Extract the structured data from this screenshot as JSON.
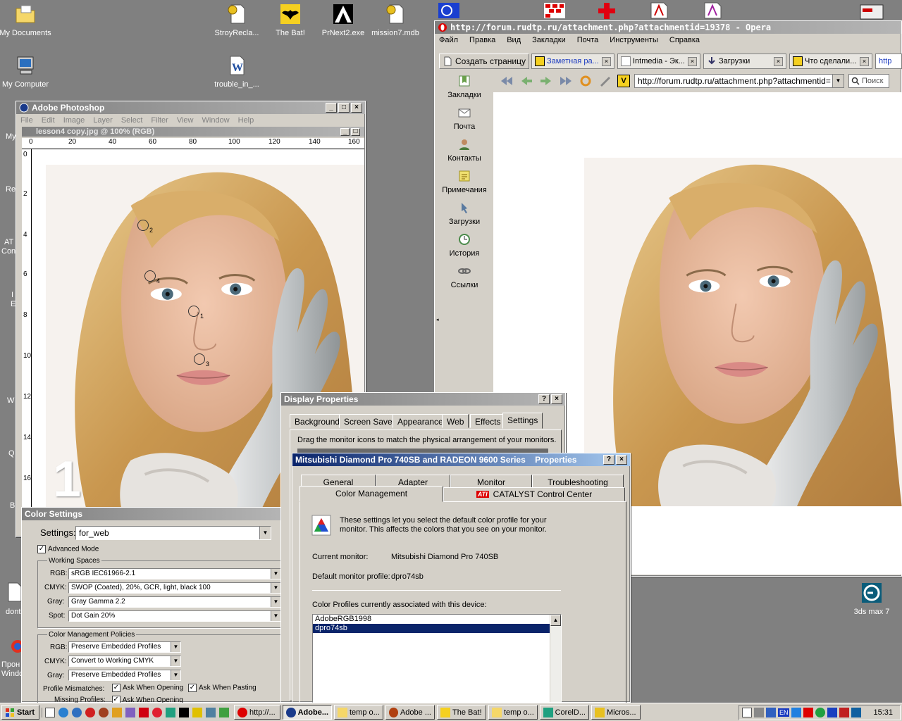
{
  "desktop": {
    "icons": [
      {
        "name": "my-documents",
        "label": "My Documents"
      },
      {
        "name": "my-computer",
        "label": "My Computer"
      },
      {
        "name": "stroyrecla",
        "label": "StroyRecla..."
      },
      {
        "name": "the-bat",
        "label": "The Bat!"
      },
      {
        "name": "prnext2",
        "label": "PrNext2.exe"
      },
      {
        "name": "mission7",
        "label": "mission7.mdb"
      },
      {
        "name": "trouble-in",
        "label": "trouble_in_..."
      },
      {
        "name": "max7",
        "label": "3ds max 7"
      }
    ],
    "edge_labels": [
      "My",
      "Re",
      "AT",
      "Con",
      "I",
      "E",
      "W",
      "Q",
      "B",
      "dont",
      "Прон",
      "Windo"
    ]
  },
  "photoshop": {
    "title": "Adobe Photoshop",
    "menu": [
      "File",
      "Edit",
      "Image",
      "Layer",
      "Select",
      "Filter",
      "View",
      "Window",
      "Help"
    ],
    "doc_title": "lesson4 copy.jpg @ 100% (RGB)",
    "ruler_h": [
      "0",
      "20",
      "40",
      "60",
      "80",
      "100",
      "120",
      "140",
      "160"
    ],
    "ruler_v": [
      "0",
      "2",
      "4",
      "6",
      "8",
      "10",
      "12",
      "14",
      "16"
    ],
    "samplers": [
      "2",
      "4",
      "1",
      "3"
    ],
    "big_number": "1"
  },
  "color_settings": {
    "title": "Color Settings",
    "settings_label": "Settings:",
    "settings_value": "for_web",
    "advanced_mode": "Advanced Mode",
    "working_spaces": "Working Spaces",
    "rgb_label": "RGB:",
    "rgb_value": "sRGB IEC61966-2.1",
    "cmyk_label": "CMYK:",
    "cmyk_value": "SWOP (Coated), 20%, GCR, light, black 100",
    "gray_label": "Gray:",
    "gray_value": "Gray Gamma 2.2",
    "spot_label": "Spot:",
    "spot_value": "Dot Gain 20%",
    "policies": "Color Management Policies",
    "p_rgb_value": "Preserve Embedded Profiles",
    "p_cmyk_value": "Convert to Working CMYK",
    "p_gray_value": "Preserve Embedded Profiles",
    "mismatch_label": "Profile Mismatches:",
    "ask_opening": "Ask When Opening",
    "ask_pasting": "Ask When Pasting",
    "missing_label": "Missing Profiles:"
  },
  "opera": {
    "title": "http://forum.rudtp.ru/attachment.php?attachmentid=19378 - Opera",
    "menu": [
      "Файл",
      "Правка",
      "Вид",
      "Закладки",
      "Почта",
      "Инструменты",
      "Справка"
    ],
    "new_page": "Создать страницу",
    "tabs": [
      "Заметная ра...",
      "Intmedia - Эк...",
      "Загрузки",
      "Что сделали...",
      "http"
    ],
    "address": "http://forum.rudtp.ru/attachment.php?attachmentid=",
    "search_placeholder": "Поиск",
    "sidebar": [
      "Закладки",
      "Почта",
      "Контакты",
      "Примечания",
      "Загрузки",
      "История",
      "Ссылки"
    ]
  },
  "display_props": {
    "title": "Display Properties",
    "tabs": [
      "Background",
      "Screen Saver",
      "Appearance",
      "Web",
      "Effects",
      "Settings"
    ],
    "hint": "Drag the monitor icons to match the physical arrangement of your monitors."
  },
  "monitor_props": {
    "title": "Mitsubishi Diamond Pro 740SB and RADEON 9600 Series    Properties",
    "tabs_row1": [
      "General",
      "Adapter",
      "Monitor",
      "Troubleshooting"
    ],
    "tabs_row2": [
      "Color Management",
      "CATALYST Control Center"
    ],
    "ati_badge": "ATI",
    "description": "These settings let you select the default color profile for your monitor. This affects the colors that you see on your monitor.",
    "current_monitor_label": "Current monitor:",
    "current_monitor_value": "Mitsubishi Diamond Pro 740SB",
    "default_profile_label": "Default monitor profile:",
    "default_profile_value": "dpro74sb",
    "profiles_label": "Color Profiles currently associated with this device:",
    "profiles": [
      "AdobeRGB1998",
      "dpro74sb"
    ]
  },
  "taskbar": {
    "start": "Start",
    "tasks": [
      "http://...",
      "Adobe...",
      "temp o...",
      "Adobe ...",
      "The Bat!",
      "temp o...",
      "CorelD...",
      "Micros..."
    ],
    "lang": "EN",
    "clock": "15:31"
  },
  "colors": {
    "active_title": "#0a246a",
    "desktop": "#808080",
    "face": "#d4d0c8",
    "selection": "#0a246a"
  }
}
